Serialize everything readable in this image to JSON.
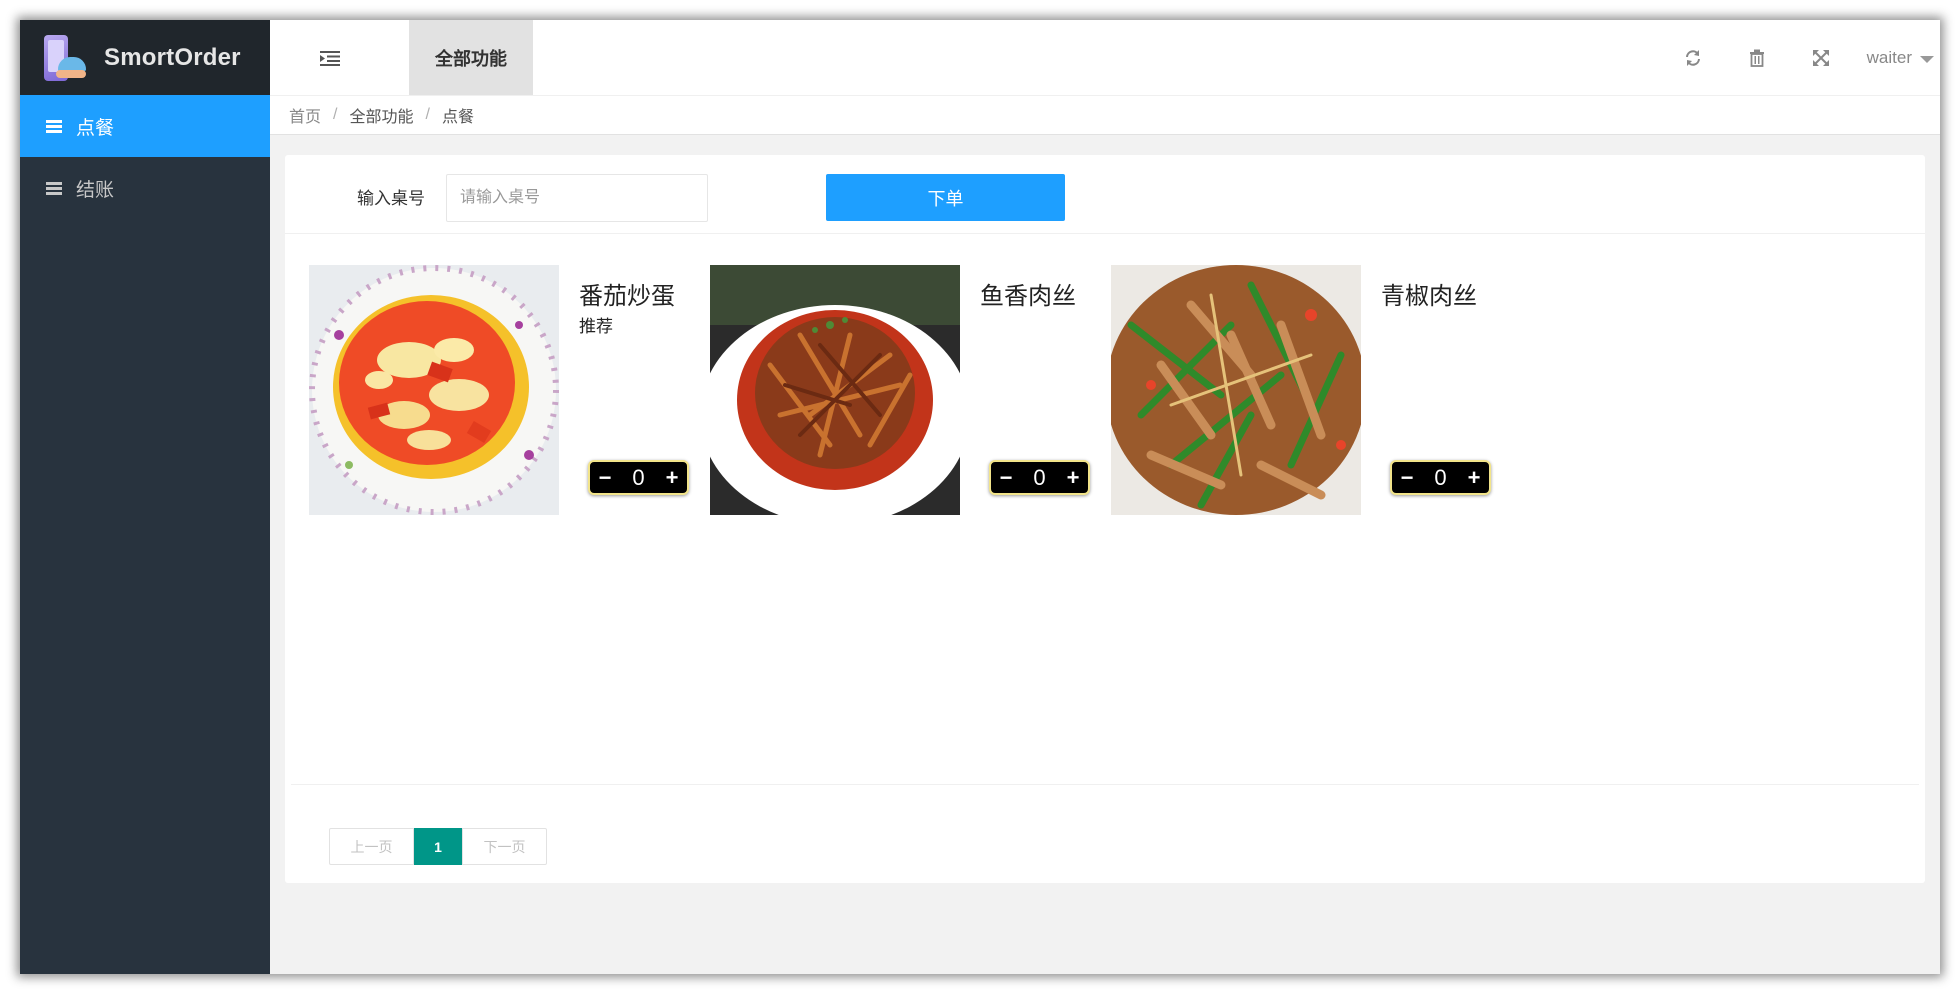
{
  "app": {
    "name": "SmortOrder"
  },
  "sidebar": {
    "items": [
      {
        "label": "点餐",
        "active": true
      },
      {
        "label": "结账",
        "active": false
      }
    ]
  },
  "header": {
    "tab_label": "全部功能",
    "icons": [
      "menu-fold-icon",
      "refresh-icon",
      "trash-icon",
      "fullscreen-icon"
    ],
    "user": "waiter"
  },
  "breadcrumb": [
    "首页",
    "全部功能",
    "点餐"
  ],
  "form": {
    "label": "输入桌号",
    "placeholder": "请输入桌号",
    "value": "",
    "submit_label": "下单"
  },
  "dishes": [
    {
      "name": "番茄炒蛋",
      "tag": "推荐",
      "quantity": "0"
    },
    {
      "name": "鱼香肉丝",
      "tag": "",
      "quantity": "0"
    },
    {
      "name": "青椒肉丝",
      "tag": "",
      "quantity": "0"
    }
  ],
  "pagination": {
    "prev": "上一页",
    "current": "1",
    "next": "下一页"
  },
  "colors": {
    "accent": "#1e9fff",
    "sidebar_bg": "#28333e",
    "brand_bg": "#20262c",
    "pager_active": "#009688"
  }
}
